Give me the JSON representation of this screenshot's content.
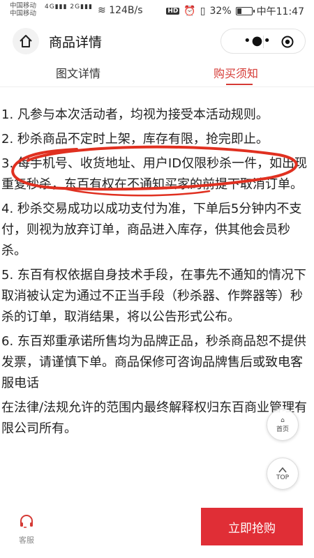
{
  "status_bar": {
    "carrier_1": "中国移动",
    "carrier_2": "中国移动",
    "signal_1": "4G",
    "signal_2": "2G",
    "speed": "124B/s",
    "hd": "HD",
    "battery": "32%",
    "battery_level": 0.32,
    "time": "中午11:47"
  },
  "nav": {
    "title": "商品详情",
    "home_icon": "home-icon",
    "more_icon": "more-dots-icon",
    "close_icon": "target-icon"
  },
  "tabs": [
    {
      "label": "图文详情",
      "active": false
    },
    {
      "label": "购买须知",
      "active": true
    }
  ],
  "rules": [
    "1. 凡参与本次活动者，均视为接受本活动规则。",
    "2. 秒杀商品不定时上架，库存有限，抢完即止。",
    "3. 每手机号、收货地址、用户ID仅限秒杀一件，如出现重复秒杀，东百有权在不通知买家的前提下取消订单。",
    "4. 秒杀交易成功以成功支付为准，下单后5分钟内不支付，则视为放弃订单，商品进入库存，供其他会员秒杀。",
    "5. 东百有权依据自身技术手段，在事先不通知的情况下取消被认定为通过不正当手段（秒杀器、作弊器等）秒杀的订单，取消结果，将以公告形式公布。",
    "6. 东百郑重承诺所售均为品牌正品，秒杀商品恕不提供发票，请谨慎下单。商品保修可咨询品牌售后或致电客服电话",
    "在法律/法规允许的范围内最终解释权归东百商业管理有限公司所有。"
  ],
  "float": {
    "home_label": "首页",
    "top_label": "TOP"
  },
  "bottom": {
    "service_label": "客服",
    "buy_label": "立即抢购"
  },
  "colors": {
    "accent": "#d53a35",
    "buy_button": "#e02e36",
    "annotation": "#e03020"
  }
}
